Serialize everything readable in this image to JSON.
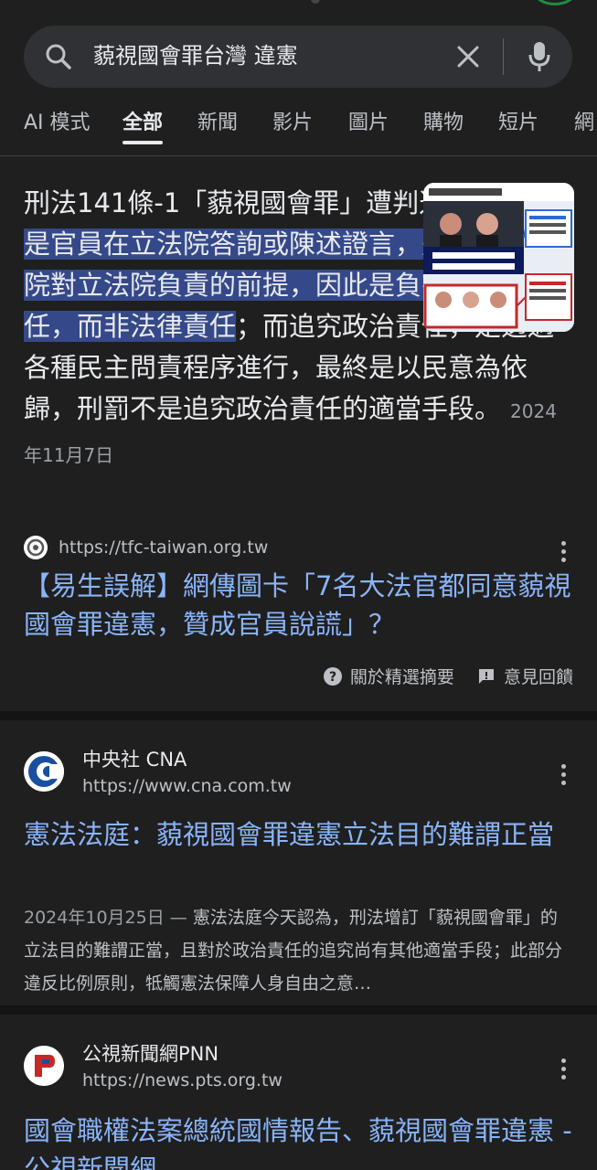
{
  "search": {
    "query": "藐視國會罪台灣 違憲"
  },
  "tabs": [
    {
      "label": "AI 模式"
    },
    {
      "label": "全部"
    },
    {
      "label": "新聞"
    },
    {
      "label": "影片"
    },
    {
      "label": "圖片"
    },
    {
      "label": "購物"
    },
    {
      "label": "短片"
    },
    {
      "label": "網"
    }
  ],
  "snippet": {
    "text_before": "刑法141條-1「藐視國會罪」遭判違憲，",
    "highlight": "理由是官員在立法院答詢或陳述證言，是基於行政院對立法院負責的前提，因此是負有政治責任，而非法律責任",
    "text_after": "；而追究政治責任，是透過各種民主問責程序進行，最終是以民意為依歸，刑罰不是追究政治責任的適當手段。",
    "date": "2024年11月7日",
    "source_url": "https://tfc-taiwan.org.tw",
    "title": "【易生誤解】網傳圖卡「7名大法官都同意藐視國會罪違憲，贊成官員說謊」？",
    "about_label": "關於精選摘要",
    "feedback_label": "意見回饋"
  },
  "results": [
    {
      "site": "中央社 CNA",
      "url": "https://www.cna.com.tw",
      "title": "憲法法庭：藐視國會罪違憲立法目的難謂正當",
      "date": "2024年10月25日",
      "description": "憲法法庭今天認為，刑法增訂「藐視國會罪」的立法目的難謂正當，且對於政治責任的追究尚有其他適當手段；此部分違反比例原則，牴觸憲法保障人身自由之意…"
    },
    {
      "site": "公視新聞網PNN",
      "url": "https://news.pts.org.tw",
      "title": "國會職權法案總統國情報告、藐視國會罪違憲 - 公視新聞網"
    }
  ],
  "colors": {
    "background": "#1f1f1f",
    "link": "#8ab4f8",
    "highlight": "#35498a",
    "search_bar": "#303134"
  }
}
